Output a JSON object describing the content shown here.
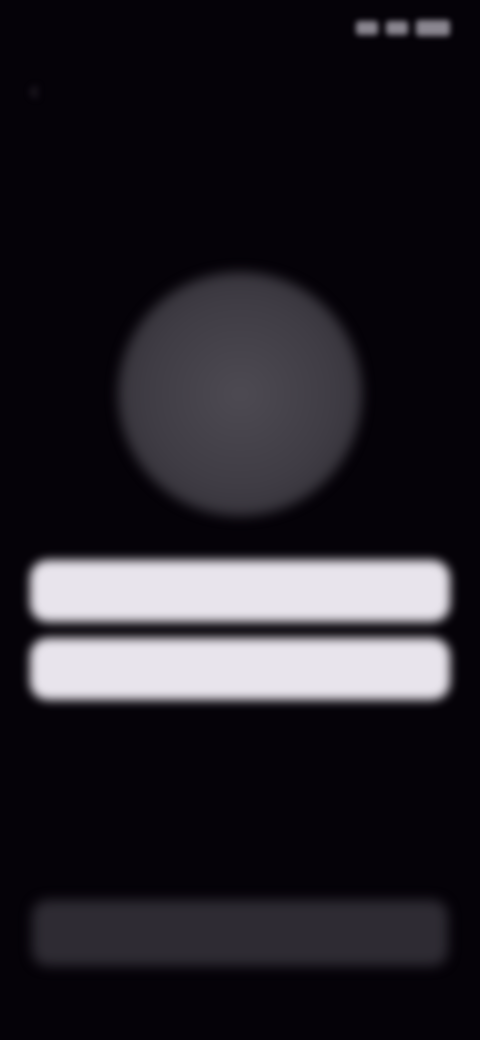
{
  "status_bar": {
    "time": "",
    "signal_icon": "signal-icon",
    "wifi_icon": "wifi-icon",
    "battery_icon": "battery-icon"
  },
  "nav": {
    "back_icon": "chevron-left-icon",
    "back_label": ""
  },
  "header": {
    "title": "",
    "subtitle": ""
  },
  "avatar": {
    "text": ""
  },
  "actions": {
    "primary_label": "",
    "secondary_label": ""
  },
  "footer": {
    "button_label": ""
  },
  "colors": {
    "background": "#050208",
    "button": "#e8e4ec",
    "avatar": "#46434b",
    "footer_button": "#2e2b33",
    "link_accent": "#1f4a44"
  }
}
